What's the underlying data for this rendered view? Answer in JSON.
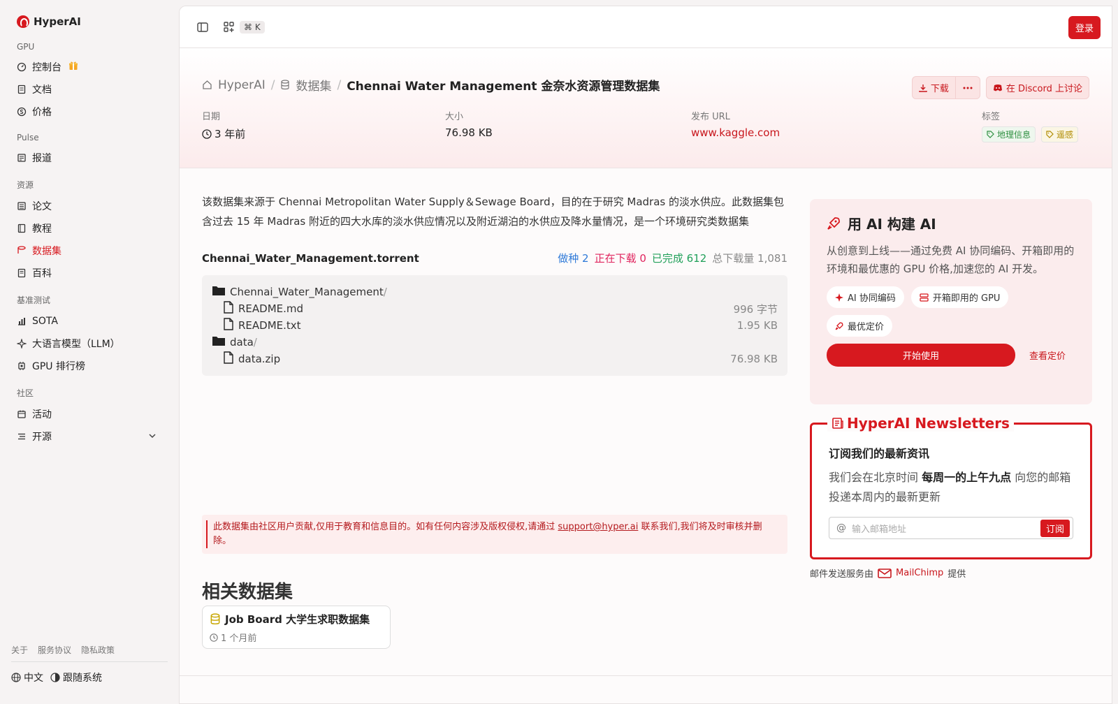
{
  "sidebar": {
    "brand": "HyperAI",
    "sections": [
      {
        "label": "GPU",
        "items": [
          {
            "label": "控制台",
            "icon": "dashboard-icon"
          },
          {
            "label": "文档",
            "icon": "doc-icon"
          },
          {
            "label": "价格",
            "icon": "dollar-icon"
          }
        ]
      },
      {
        "label": "Pulse",
        "items": [
          {
            "label": "报道",
            "icon": "news-icon"
          }
        ]
      },
      {
        "label": "资源",
        "items": [
          {
            "label": "论文",
            "icon": "paper-icon"
          },
          {
            "label": "教程",
            "icon": "book-icon"
          },
          {
            "label": "数据集",
            "icon": "database-icon",
            "active": true
          },
          {
            "label": "百科",
            "icon": "wiki-icon"
          }
        ]
      },
      {
        "label": "基准测试",
        "items": [
          {
            "label": "SOTA",
            "icon": "chart-icon"
          },
          {
            "label": "大语言模型（LLM）",
            "icon": "sparkle-icon"
          },
          {
            "label": "GPU 排行榜",
            "icon": "chip-icon"
          }
        ]
      },
      {
        "label": "社区",
        "items": [
          {
            "label": "活动",
            "icon": "calendar-icon"
          },
          {
            "label": "开源",
            "icon": "list-icon"
          }
        ]
      }
    ],
    "footer_links": [
      "关于",
      "服务协议",
      "隐私政策"
    ],
    "language": "中文",
    "theme": "跟随系统"
  },
  "topbar": {
    "shortcut": "⌘ K",
    "login": "登录"
  },
  "header": {
    "breadcrumb": [
      "HyperAI",
      "数据集",
      "Chennai Water Management 金奈水资源管理数据集"
    ],
    "download": "下载",
    "discord": "在 Discord 上讨论",
    "meta": {
      "date_label": "日期",
      "date_value": "3 年前",
      "size_label": "大小",
      "size_value": "76.98 KB",
      "url_label": "发布 URL",
      "url_value": "www.kaggle.com",
      "tags_label": "标签",
      "tags": [
        "地理信息",
        "遥感"
      ]
    }
  },
  "content": {
    "description": "该数据集来源于 Chennai Metropolitan Water Supply＆Sewage Board，目的在于研究 Madras 的淡水供应。此数据集包含过去 15 年 Madras 附近的四大水库的淡水供应情况以及附近湖泊的水供应及降水量情况，是一个环境研究类数据集",
    "torrent_name": "Chennai_Water_Management.torrent",
    "seeders": "做种 2",
    "downloading": "正在下载 0",
    "completed": "已完成 612",
    "total": "总下载量 1,081",
    "files": [
      {
        "name": "Chennai_Water_Management",
        "type": "folder",
        "size": "",
        "indent": false
      },
      {
        "name": "README.md",
        "type": "file",
        "size": "996 字节",
        "indent": true
      },
      {
        "name": "README.txt",
        "type": "file",
        "size": "1.95 KB",
        "indent": true
      },
      {
        "name": "data",
        "type": "folder",
        "size": "",
        "indent": false
      },
      {
        "name": "data.zip",
        "type": "file",
        "size": "76.98 KB",
        "indent": true
      }
    ],
    "notice_pre": "此数据集由社区用户贡献,仅用于教育和信息目的。如有任何内容涉及版权侵权,请通过",
    "notice_email": "support@hyper.ai",
    "notice_post": "联系我们,我们将及时审核并删除。",
    "related_title": "相关数据集",
    "related": {
      "title": "Job Board 大学生求职数据集",
      "date": "1 个月前"
    }
  },
  "ai_card": {
    "title": "用 AI 构建 AI",
    "body": "从创意到上线——通过免费 AI 协同编码、开箱即用的环境和最优惠的 GPU 价格,加速您的 AI 开发。",
    "pills": [
      "AI 协同编码",
      "开箱即用的 GPU",
      "最优定价"
    ],
    "start": "开始使用",
    "pricing": "查看定价"
  },
  "newsletter": {
    "legend": "HyperAI Newsletters",
    "title": "订阅我们的最新资讯",
    "body_pre": "我们会在北京时间",
    "body_bold": "每周一的上午九点",
    "body_post": "向您的邮箱投递本周内的最新更新",
    "placeholder": "输入邮箱地址",
    "subscribe": "订阅",
    "provider_pre": "邮件发送服务由",
    "provider": "MailChimp",
    "provider_post": "提供"
  }
}
